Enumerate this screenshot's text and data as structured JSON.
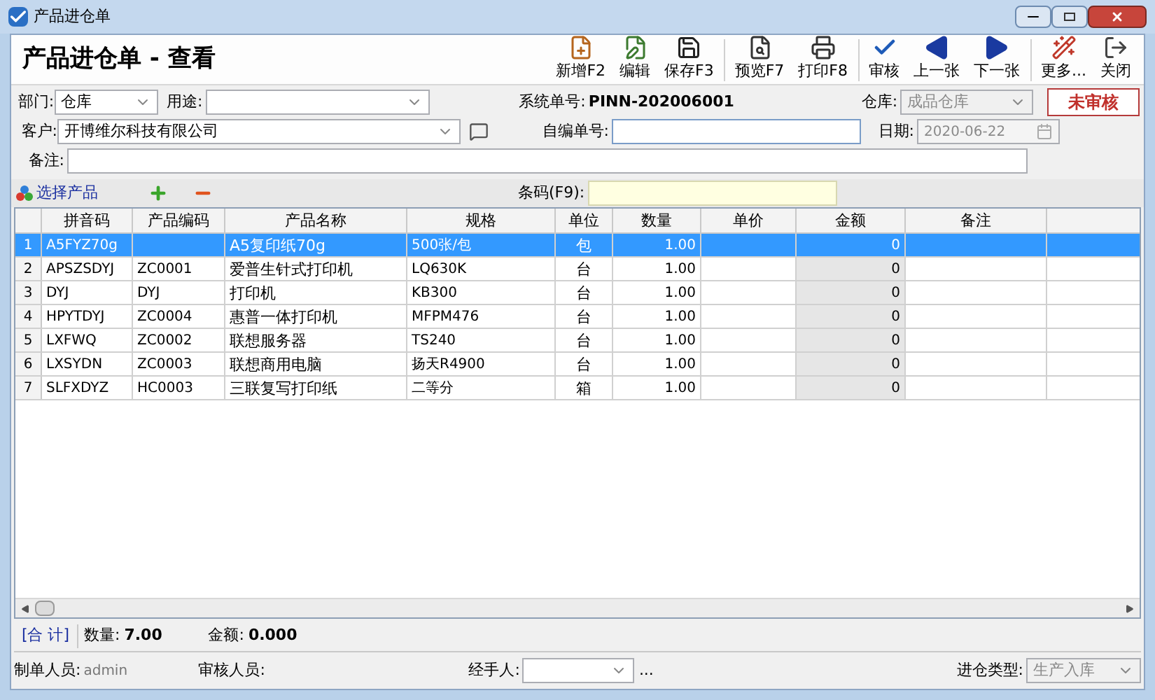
{
  "window": {
    "title": "产品进仓单"
  },
  "header": {
    "title": "产品进仓单 - 查看"
  },
  "toolbar": [
    {
      "label": "新增F2"
    },
    {
      "label": "编辑"
    },
    {
      "label": "保存F3"
    },
    {
      "label": "预览F7"
    },
    {
      "label": "打印F8"
    },
    {
      "label": "审核"
    },
    {
      "label": "上一张"
    },
    {
      "label": "下一张"
    },
    {
      "label": "更多..."
    },
    {
      "label": "关闭"
    }
  ],
  "form": {
    "department": {
      "label": "部门:",
      "value": "仓库"
    },
    "usage": {
      "label": "用途:"
    },
    "system_no": {
      "label": "系统单号:",
      "value": "PINN-202006001"
    },
    "warehouse": {
      "label": "仓库:",
      "value": "成品仓库",
      "disabled": true
    },
    "status_badge": "未审核",
    "customer": {
      "label": "客户:",
      "value": "开博维尔科技有限公司"
    },
    "custom_no": {
      "label": "自编单号:"
    },
    "date": {
      "label": "日期:",
      "value": "2020-06-22",
      "disabled": true
    },
    "remark": {
      "label": "备注:"
    }
  },
  "items_bar": {
    "select_label": "选择产品",
    "barcode_label": "条码(F9):"
  },
  "table": {
    "columns": [
      "拼音码",
      "产品编码",
      "产品名称",
      "规格",
      "单位",
      "数量",
      "单价",
      "金额",
      "备注"
    ],
    "rows": [
      {
        "no": "1",
        "pinyin": "A5FYZ70g",
        "code": "",
        "name": "A5复印纸70g",
        "spec": "500张/包",
        "unit": "包",
        "qty": "1.00",
        "amount": "0",
        "selected": true
      },
      {
        "no": "2",
        "pinyin": "APSZSDYJ",
        "code": "ZC0001",
        "name": "爱普生针式打印机",
        "spec": "LQ630K",
        "unit": "台",
        "qty": "1.00",
        "amount": "0",
        "selected": false
      },
      {
        "no": "3",
        "pinyin": "DYJ",
        "code": "DYJ",
        "name": "打印机",
        "spec": "KB300",
        "unit": "台",
        "qty": "1.00",
        "amount": "0",
        "selected": false
      },
      {
        "no": "4",
        "pinyin": "HPYTDYJ",
        "code": "ZC0004",
        "name": "惠普一体打印机",
        "spec": "MFPM476",
        "unit": "台",
        "qty": "1.00",
        "amount": "0",
        "selected": false
      },
      {
        "no": "5",
        "pinyin": "LXFWQ",
        "code": "ZC0002",
        "name": "联想服务器",
        "spec": "TS240",
        "unit": "台",
        "qty": "1.00",
        "amount": "0",
        "selected": false
      },
      {
        "no": "6",
        "pinyin": "LXSYDN",
        "code": "ZC0003",
        "name": "联想商用电脑",
        "spec": "扬天R4900",
        "unit": "台",
        "qty": "1.00",
        "amount": "0",
        "selected": false
      },
      {
        "no": "7",
        "pinyin": "SLFXDYZ",
        "code": "HC0003",
        "name": "三联复写打印纸",
        "spec": "二等分",
        "unit": "箱",
        "qty": "1.00",
        "amount": "0",
        "selected": false
      }
    ]
  },
  "totals": {
    "label": "[合 计]",
    "qty_label": "数量:",
    "qty": "7.00",
    "amount_label": "金额:",
    "amount": "0.000"
  },
  "footer": {
    "creator_label": "制单人员:",
    "creator": "admin",
    "reviewer_label": "审核人员:",
    "handler_label": "经手人:",
    "handler_more": "...",
    "type_label": "进仓类型:",
    "type_value": "生产入库",
    "type_disabled": true
  }
}
